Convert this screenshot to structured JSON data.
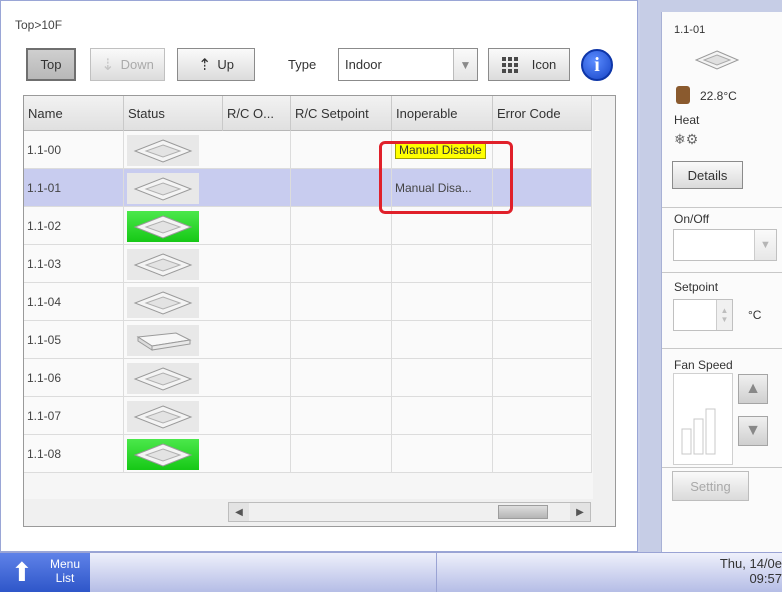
{
  "breadcrumb": "Top>10F",
  "toolbar": {
    "top_label": "Top",
    "down_label": "Down",
    "up_label": "Up",
    "type_label": "Type",
    "type_value": "Indoor",
    "icon_view_label": "Icon"
  },
  "table": {
    "columns": [
      "Name",
      "Status",
      "R/C O...",
      "R/C Setpoint",
      "Inoperable",
      "Error Code"
    ],
    "rows": [
      {
        "name": "1.1-00",
        "status": "off",
        "inoperable": "Manual Disable"
      },
      {
        "name": "1.1-01",
        "status": "off",
        "inoperable": "Manual Disa..."
      },
      {
        "name": "1.1-02",
        "status": "on",
        "inoperable": ""
      },
      {
        "name": "1.1-03",
        "status": "off",
        "inoperable": ""
      },
      {
        "name": "1.1-04",
        "status": "off",
        "inoperable": ""
      },
      {
        "name": "1.1-05",
        "status": "off",
        "inoperable": ""
      },
      {
        "name": "1.1-06",
        "status": "off",
        "inoperable": ""
      },
      {
        "name": "1.1-07",
        "status": "off",
        "inoperable": ""
      },
      {
        "name": "1.1-08",
        "status": "on",
        "inoperable": ""
      }
    ],
    "selected_row": "1.1-01"
  },
  "detail": {
    "unit_name": "1.1-01",
    "temperature": "22.8°C",
    "mode": "Heat",
    "details_label": "Details",
    "onoff_label": "On/Off",
    "setpoint_label": "Setpoint",
    "setpoint_unit": "°C",
    "fan_speed_label": "Fan Speed",
    "setting_label": "Setting"
  },
  "taskbar": {
    "menu_line1": "Menu",
    "menu_line2": "List",
    "date": "Thu, 14/0e",
    "time": "09:57"
  },
  "colors": {
    "status_on": "#22d022",
    "selected_row": "#c8ccef",
    "highlight": "#e0202a",
    "tag_yellow": "#ffff00",
    "info_blue": "#1644c6"
  }
}
